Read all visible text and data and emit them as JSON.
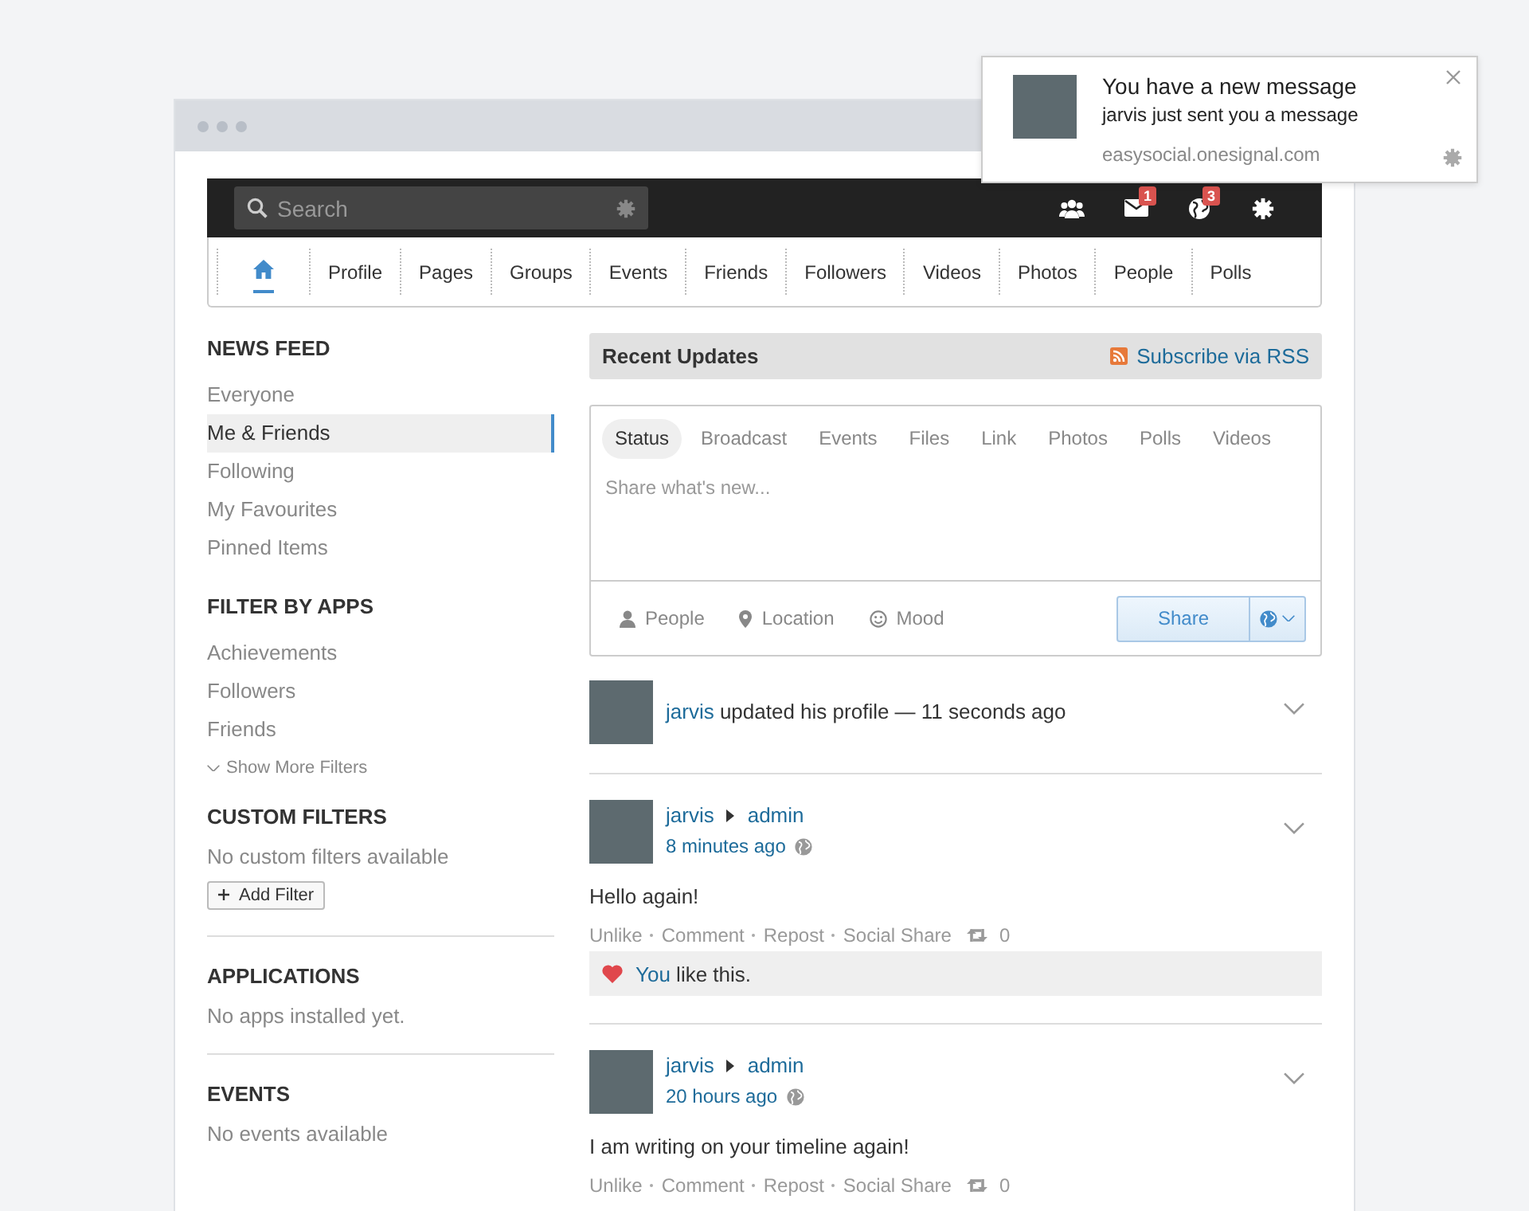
{
  "notification": {
    "title": "You have a new message",
    "message": "jarvis just sent you a message",
    "domain": "easysocial.onesignal.com"
  },
  "toolbar": {
    "search_placeholder": "Search",
    "icons": [
      {
        "kind": "friends"
      },
      {
        "kind": "messages",
        "badge": "1"
      },
      {
        "kind": "notifications",
        "badge": "3"
      },
      {
        "kind": "settings"
      }
    ]
  },
  "nav": [
    {
      "kind": "home",
      "selected": true
    },
    {
      "label": "Profile",
      "selected": false
    },
    {
      "label": "Pages",
      "selected": false
    },
    {
      "label": "Groups",
      "selected": false
    },
    {
      "label": "Events",
      "selected": false
    },
    {
      "label": "Friends",
      "selected": false
    },
    {
      "label": "Followers",
      "selected": false
    },
    {
      "label": "Videos",
      "selected": false
    },
    {
      "label": "Photos",
      "selected": false
    },
    {
      "label": "People",
      "selected": false
    },
    {
      "label": "Polls",
      "selected": false
    }
  ],
  "sidebar": [
    {
      "title": "NEWS FEED",
      "items": [
        {
          "label": "Everyone",
          "selected": false
        },
        {
          "label": "Me & Friends",
          "selected": true
        },
        {
          "label": "Following",
          "selected": false
        },
        {
          "label": "My Favourites",
          "selected": false
        },
        {
          "label": "Pinned Items",
          "selected": false
        }
      ]
    },
    {
      "title": "FILTER BY APPS",
      "items": [
        {
          "label": "Achievements",
          "selected": false
        },
        {
          "label": "Followers",
          "selected": false
        },
        {
          "label": "Friends",
          "selected": false
        }
      ],
      "more": "Show More Filters"
    },
    {
      "title": "CUSTOM FILTERS",
      "note": "No custom filters available",
      "button": "Add Filter"
    },
    {
      "title": "APPLICATIONS",
      "note": "No apps installed yet."
    },
    {
      "title": "EVENTS",
      "note": "No events available"
    }
  ],
  "recent_updates": {
    "title": "Recent Updates",
    "rss_link": "Subscribe via RSS"
  },
  "composer": {
    "tabs": [
      {
        "label": "Status",
        "selected": true
      },
      {
        "label": "Broadcast",
        "selected": false
      },
      {
        "label": "Events",
        "selected": false
      },
      {
        "label": "Files",
        "selected": false
      },
      {
        "label": "Link",
        "selected": false
      },
      {
        "label": "Photos",
        "selected": false
      },
      {
        "label": "Polls",
        "selected": false
      },
      {
        "label": "Videos",
        "selected": false
      }
    ],
    "placeholder": "Share what's new...",
    "actions": [
      {
        "kind": "people",
        "label": "People"
      },
      {
        "kind": "location",
        "label": "Location"
      },
      {
        "kind": "mood",
        "label": "Mood"
      }
    ],
    "share_button": "Share"
  },
  "feed": [
    {
      "kind": "activity",
      "actor": "jarvis",
      "text": "updated his profile — 11 seconds ago"
    },
    {
      "kind": "post",
      "actor": "jarvis",
      "target": "admin",
      "time": "8 minutes ago",
      "body": "Hello again!",
      "actions": [
        "Unlike",
        "Comment",
        "Repost",
        "Social Share"
      ],
      "repost_count": "0",
      "likes": {
        "who": "You",
        "text": "like this."
      }
    },
    {
      "kind": "post",
      "actor": "jarvis",
      "target": "admin",
      "time": "20 hours ago",
      "body": "I am writing on your timeline again!",
      "actions": [
        "Unlike",
        "Comment",
        "Repost",
        "Social Share"
      ],
      "repost_count": "0"
    }
  ]
}
